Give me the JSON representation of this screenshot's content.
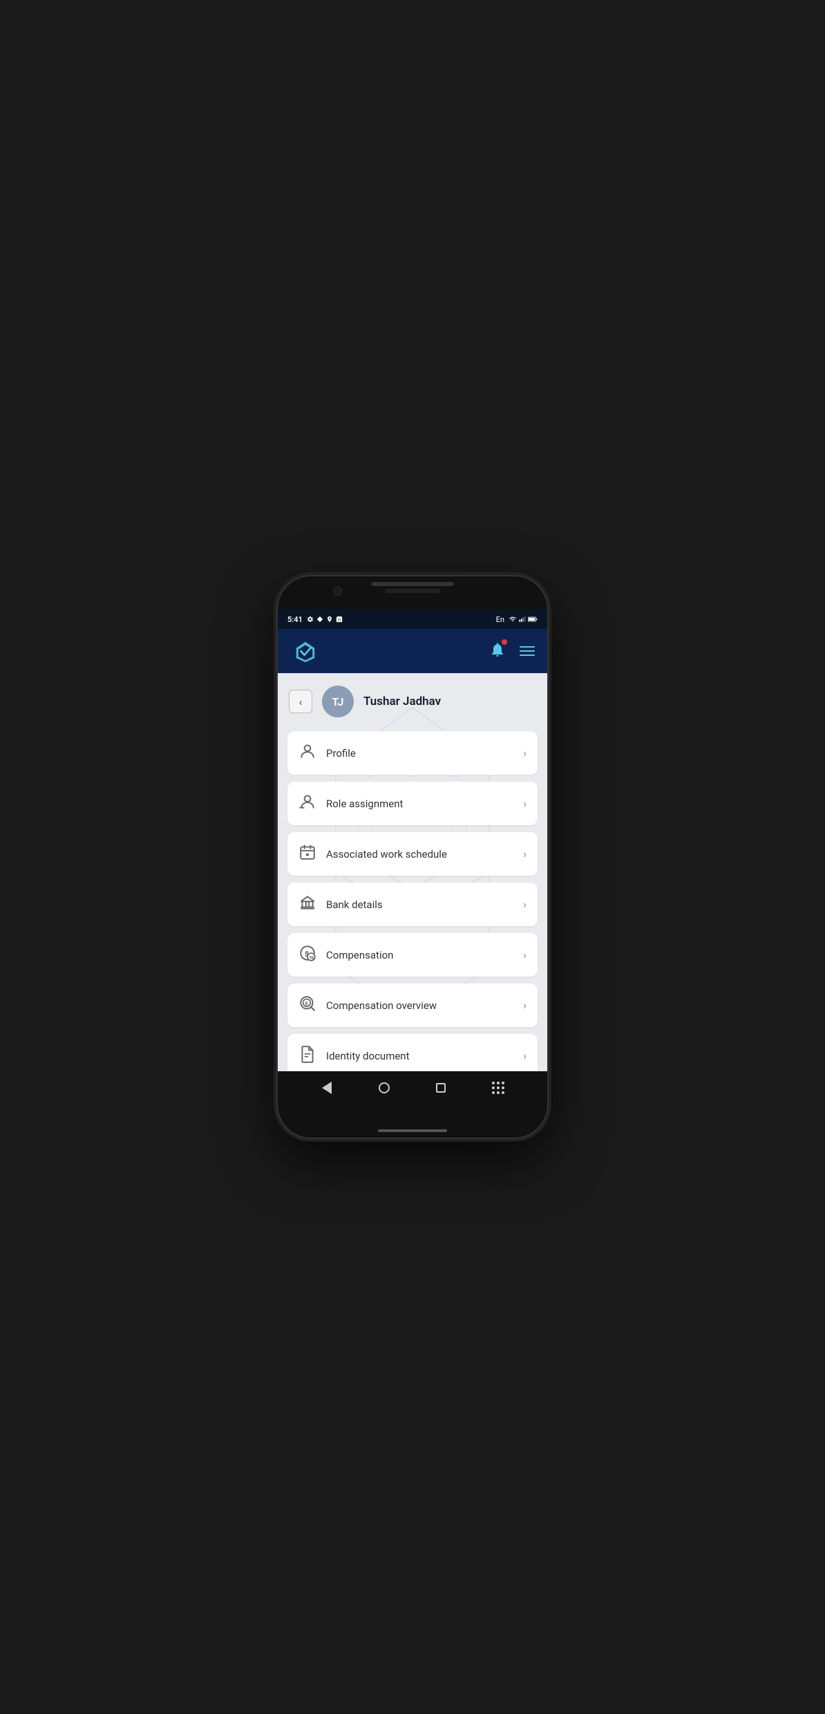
{
  "status_bar": {
    "time": "5:41",
    "language": "En"
  },
  "header": {
    "logo_alt": "App Logo",
    "notification_has_dot": true,
    "menu_label": "Menu"
  },
  "user": {
    "initials": "TJ",
    "name": "Tushar Jadhav"
  },
  "menu_items": [
    {
      "id": "profile",
      "label": "Profile",
      "icon": "person"
    },
    {
      "id": "role-assignment",
      "label": "Role assignment",
      "icon": "role"
    },
    {
      "id": "associated-work-schedule",
      "label": "Associated work schedule",
      "icon": "schedule"
    },
    {
      "id": "bank-details",
      "label": "Bank details",
      "icon": "bank"
    },
    {
      "id": "compensation",
      "label": "Compensation",
      "icon": "compensation"
    },
    {
      "id": "compensation-overview",
      "label": "Compensation overview",
      "icon": "compensation-overview"
    },
    {
      "id": "identity-document",
      "label": "Identity document",
      "icon": "document"
    }
  ],
  "colors": {
    "header_bg": "#0d2453",
    "accent": "#5bc8e8",
    "item_bg": "#ffffff",
    "page_bg": "#e8eaed"
  }
}
